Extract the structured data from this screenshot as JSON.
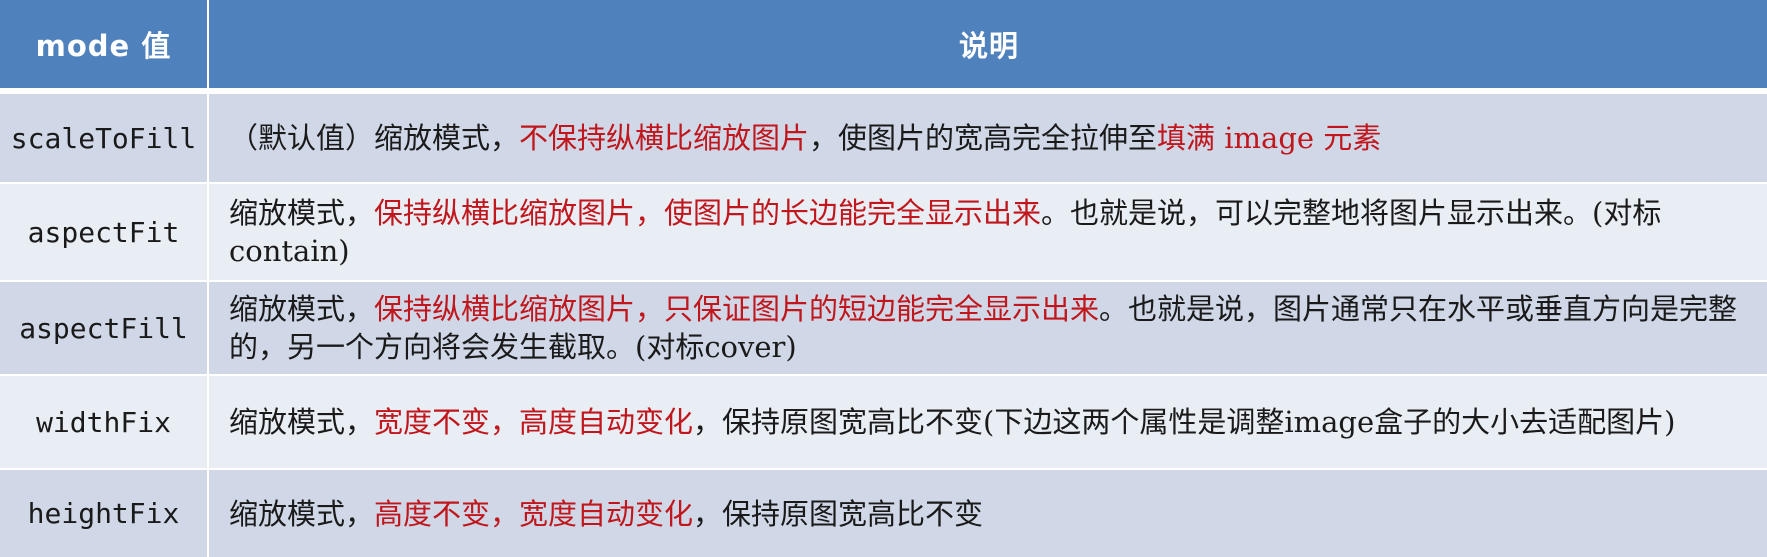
{
  "header": {
    "mode_col": "mode 值",
    "desc_col": "说明"
  },
  "rows": [
    {
      "mode": "scaleToFill",
      "desc": [
        {
          "text": "（默认值）缩放模式，",
          "red": false
        },
        {
          "text": "不保持纵横比缩放图片",
          "red": true
        },
        {
          "text": "，使图片的宽高完全拉伸至",
          "red": false
        },
        {
          "text": "填满 image 元素",
          "red": true
        }
      ]
    },
    {
      "mode": "aspectFit",
      "desc": [
        {
          "text": "缩放模式，",
          "red": false
        },
        {
          "text": "保持纵横比缩放图片，使图片的长边能完全显示出来",
          "red": true
        },
        {
          "text": "。也就是说，可以完整地将图片显示出来。(对标contain)",
          "red": false
        }
      ]
    },
    {
      "mode": "aspectFill",
      "desc": [
        {
          "text": "缩放模式，",
          "red": false
        },
        {
          "text": "保持纵横比缩放图片，只保证图片的短边能完全显示出来",
          "red": true
        },
        {
          "text": "。也就是说，图片通常只在水平或垂直方向是完整的，另一个方向将会发生截取。(对标cover)",
          "red": false
        }
      ]
    },
    {
      "mode": "widthFix",
      "desc": [
        {
          "text": "缩放模式，",
          "red": false
        },
        {
          "text": "宽度不变，高度自动变化",
          "red": true
        },
        {
          "text": "，保持原图宽高比不变(下边这两个属性是调整image盒子的大小去适配图片)",
          "red": false
        }
      ]
    },
    {
      "mode": "heightFix",
      "desc": [
        {
          "text": "缩放模式，",
          "red": false
        },
        {
          "text": "高度不变，宽度自动变化",
          "red": true
        },
        {
          "text": "，保持原图宽高比不变",
          "red": false
        }
      ]
    }
  ],
  "colors": {
    "header_bg": "#4f81bd",
    "row_dark": "#d0d8e8",
    "row_light": "#e9edf4",
    "highlight_red": "#c0161c"
  }
}
